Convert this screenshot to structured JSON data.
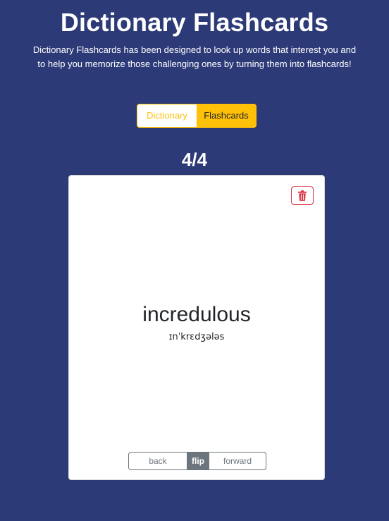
{
  "header": {
    "title": "Dictionary Flashcards",
    "subtitle": "Dictionary Flashcards has been designed to look up words that interest you and to help you memorize those challenging ones by turning them into flashcards!"
  },
  "mode_toggle": {
    "options": [
      "Dictionary",
      "Flashcards"
    ],
    "selected": "Flashcards"
  },
  "counter": "4/4",
  "card": {
    "word": "incredulous",
    "phonetic": "ɪnˈkrɛdʒələs",
    "delete_icon": "trash-icon"
  },
  "card_nav": {
    "back_label": "back",
    "flip_label": "flip",
    "forward_label": "forward"
  },
  "colors": {
    "background": "#2d3a78",
    "accent": "#ffc107",
    "danger": "#dc3545",
    "secondary": "#6c757d"
  }
}
